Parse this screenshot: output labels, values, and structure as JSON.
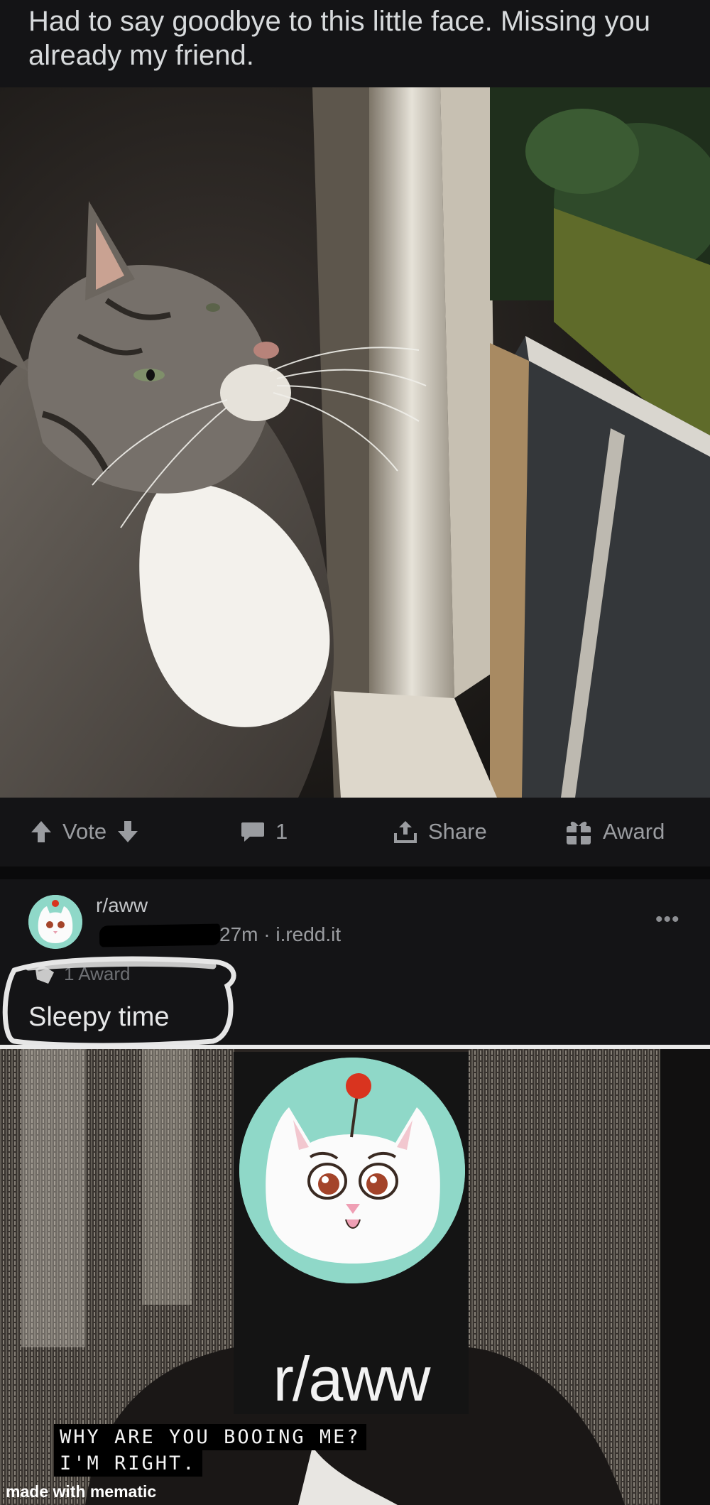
{
  "post": {
    "title": "Had to say goodbye to this little face. Missing you already my friend.",
    "image_alt": "Tabby cat with white chest looking out an open window"
  },
  "actions": {
    "vote_label": "Vote",
    "comment_count": "1",
    "share_label": "Share",
    "award_label": "Award"
  },
  "embedded_post": {
    "subreddit": "r/aww",
    "meta": "27m · i.redd.it",
    "award_text": "1 Award",
    "title": "Sleepy time",
    "more_icon": "more-dots-icon"
  },
  "meme": {
    "logo_text": "r/aww",
    "caption_line_1": "WHY ARE YOU BOOING ME?",
    "caption_line_2": "I'M RIGHT.",
    "watermark": "made with mematic"
  },
  "colors": {
    "background": "#141416",
    "text": "#d7dadc",
    "muted": "#9a9ca0",
    "avatar_mint": "#8fd8c8",
    "alien_ball": "#d9341f"
  }
}
